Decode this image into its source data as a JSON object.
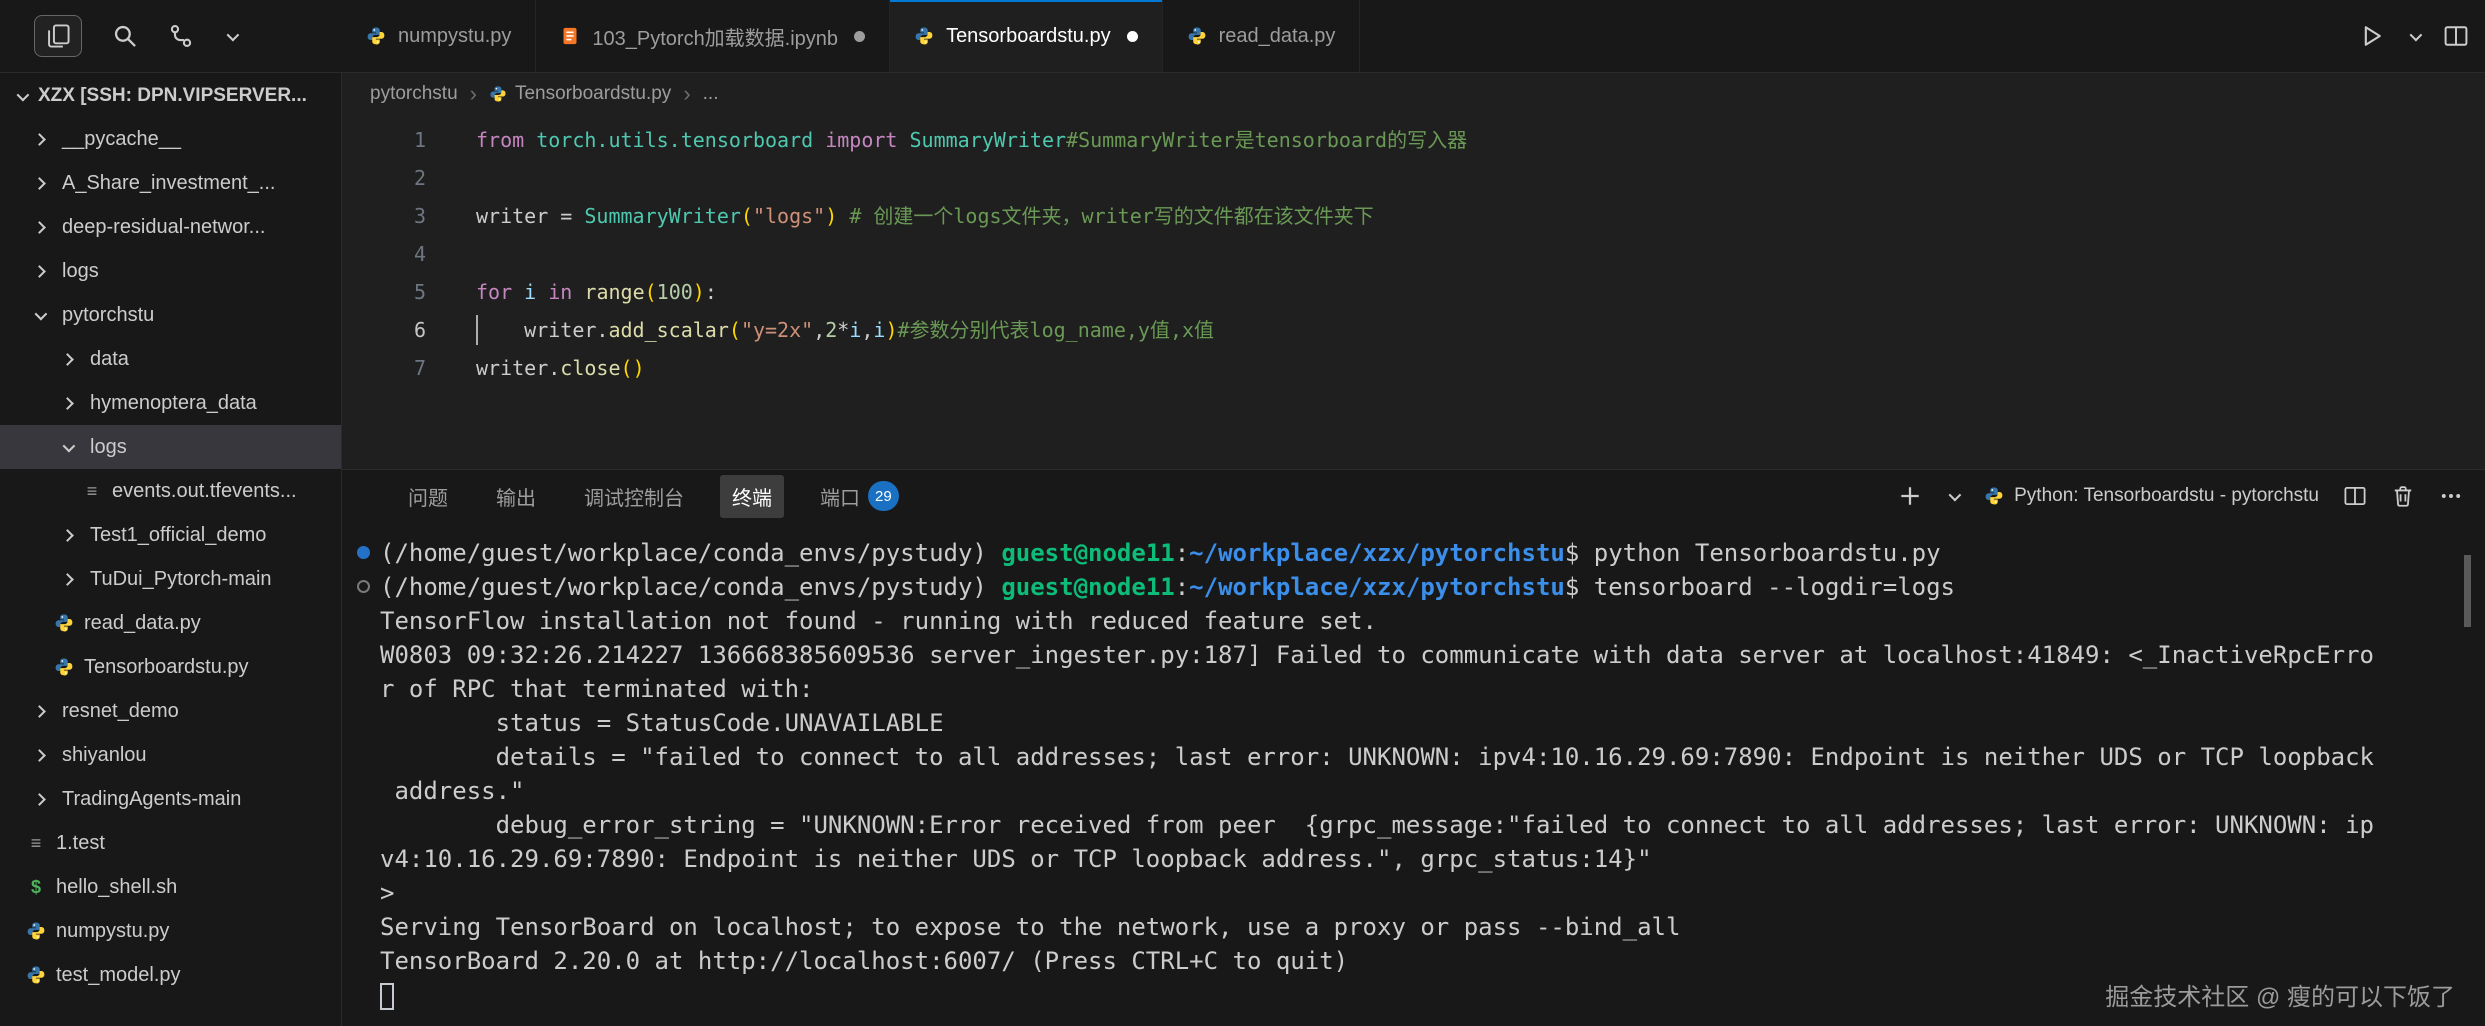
{
  "colors": {
    "accent_blue": "#0078d4",
    "terminal_green": "#0dbc79",
    "terminal_blue": "#3b8eea",
    "badge_blue": "#1a70c2",
    "python_blue": "#3776ab",
    "python_yellow": "#ffd43b",
    "notebook_orange": "#f37726",
    "shell_green": "#4eb15b"
  },
  "titlebar": {
    "activity_icons": [
      {
        "name": "files-icon",
        "key": "files",
        "boxed": true
      },
      {
        "name": "search-icon",
        "key": "search",
        "boxed": false
      },
      {
        "name": "source-control-graph-icon",
        "key": "graph",
        "boxed": false
      },
      {
        "name": "views-chevron-down-icon",
        "key": "chev-down",
        "boxed": false
      }
    ],
    "editor_actions": [
      {
        "name": "run-python-file-icon",
        "key": "run"
      },
      {
        "name": "run-dropdown-chevron-icon",
        "key": "chev-down"
      },
      {
        "name": "split-editor-icon",
        "key": "split"
      }
    ],
    "tabs": [
      {
        "label": "numpystu.py",
        "icon": "python",
        "modified": false,
        "active": false
      },
      {
        "label": "103_Pytorch加载数据.ipynb",
        "icon": "notebook",
        "modified": true,
        "active": false
      },
      {
        "label": "Tensorboardstu.py",
        "icon": "python",
        "modified": true,
        "active": true
      },
      {
        "label": "read_data.py",
        "icon": "python",
        "modified": false,
        "active": false
      }
    ]
  },
  "sidebar": {
    "title": "XZX [SSH: DPN.VIPSERVER...",
    "items": [
      {
        "label": "__pycache__",
        "kind": "folder",
        "level": 0,
        "expanded": false
      },
      {
        "label": "A_Share_investment_...",
        "kind": "folder",
        "level": 0,
        "expanded": false
      },
      {
        "label": "deep-residual-networ...",
        "kind": "folder",
        "level": 0,
        "expanded": false
      },
      {
        "label": "logs",
        "kind": "folder",
        "level": 0,
        "expanded": false
      },
      {
        "label": "pytorchstu",
        "kind": "folder",
        "level": 0,
        "expanded": true
      },
      {
        "label": "data",
        "kind": "folder",
        "level": 1,
        "expanded": false
      },
      {
        "label": "hymenoptera_data",
        "kind": "folder",
        "level": 1,
        "expanded": false
      },
      {
        "label": "logs",
        "kind": "folder",
        "level": 1,
        "expanded": true,
        "selected": true
      },
      {
        "label": "events.out.tfevents...",
        "kind": "file",
        "icon": "list",
        "level": 2
      },
      {
        "label": "Test1_official_demo",
        "kind": "folder",
        "level": 1,
        "expanded": false
      },
      {
        "label": "TuDui_Pytorch-main",
        "kind": "folder",
        "level": 1,
        "expanded": false
      },
      {
        "label": "read_data.py",
        "kind": "file",
        "icon": "python",
        "level": 1
      },
      {
        "label": "Tensorboardstu.py",
        "kind": "file",
        "icon": "python",
        "level": 1
      },
      {
        "label": "resnet_demo",
        "kind": "folder",
        "level": 0,
        "expanded": false
      },
      {
        "label": "shiyanlou",
        "kind": "folder",
        "level": 0,
        "expanded": false
      },
      {
        "label": "TradingAgents-main",
        "kind": "folder",
        "level": 0,
        "expanded": false
      },
      {
        "label": "1.test",
        "kind": "file",
        "icon": "list",
        "level": 0
      },
      {
        "label": "hello_shell.sh",
        "kind": "file",
        "icon": "shell",
        "level": 0
      },
      {
        "label": "numpystu.py",
        "kind": "file",
        "icon": "python",
        "level": 0
      },
      {
        "label": "test_model.py",
        "kind": "file",
        "icon": "python",
        "level": 0
      }
    ]
  },
  "breadcrumb": [
    {
      "label": "pytorchstu"
    },
    {
      "label": "Tensorboardstu.py",
      "icon": "python"
    },
    {
      "label": "..."
    }
  ],
  "editor": {
    "lines": [
      {
        "num": "1",
        "tokens": [
          [
            "from",
            "kw"
          ],
          [
            " ",
            "pln"
          ],
          [
            "torch.utils.tensorboard",
            "type"
          ],
          [
            " ",
            "pln"
          ],
          [
            "import",
            "kw"
          ],
          [
            " ",
            "pln"
          ],
          [
            "SummaryWriter",
            "type"
          ],
          [
            "#SummaryWriter是tensorboard的写入器",
            "cmt"
          ]
        ]
      },
      {
        "num": "2",
        "tokens": []
      },
      {
        "num": "3",
        "tokens": [
          [
            "writer",
            "pln"
          ],
          [
            " = ",
            "pln"
          ],
          [
            "SummaryWriter",
            "type"
          ],
          [
            "(",
            "brk"
          ],
          [
            "\"logs\"",
            "str"
          ],
          [
            ")",
            "brk"
          ],
          [
            " ",
            "pln"
          ],
          [
            "# 创建一个logs文件夹，writer写的文件都在该文件夹下",
            "cmt"
          ]
        ]
      },
      {
        "num": "4",
        "tokens": []
      },
      {
        "num": "5",
        "tokens": [
          [
            "for",
            "kw"
          ],
          [
            " ",
            "pln"
          ],
          [
            "i",
            "var"
          ],
          [
            " ",
            "pln"
          ],
          [
            "in",
            "kw"
          ],
          [
            " ",
            "pln"
          ],
          [
            "range",
            "fn"
          ],
          [
            "(",
            "brk"
          ],
          [
            "100",
            "num"
          ],
          [
            ")",
            "brk"
          ],
          [
            ":",
            "pln"
          ]
        ]
      },
      {
        "num": "6",
        "cursor": true,
        "tokens": [
          [
            "    ",
            "pln"
          ],
          [
            "writer",
            "pln"
          ],
          [
            ".",
            "pln"
          ],
          [
            "add_scalar",
            "fn"
          ],
          [
            "(",
            "brk"
          ],
          [
            "\"y=2x\"",
            "str"
          ],
          [
            ",",
            "pln"
          ],
          [
            "2",
            "num"
          ],
          [
            "*",
            "pln"
          ],
          [
            "i",
            "var"
          ],
          [
            ",",
            "pln"
          ],
          [
            "i",
            "var"
          ],
          [
            ")",
            "brk"
          ],
          [
            "#参数分别代表log_name,y值,x值",
            "cmt"
          ]
        ]
      },
      {
        "num": "7",
        "tokens": [
          [
            "writer",
            "pln"
          ],
          [
            ".",
            "pln"
          ],
          [
            "close",
            "fn"
          ],
          [
            "(",
            "brk"
          ],
          [
            ")",
            "brk"
          ]
        ]
      }
    ]
  },
  "panel": {
    "tabs": [
      {
        "label": "问题",
        "active": false
      },
      {
        "label": "输出",
        "active": false
      },
      {
        "label": "调试控制台",
        "active": false
      },
      {
        "label": "终端",
        "active": true
      },
      {
        "label": "端口",
        "active": false,
        "badge": "29"
      }
    ],
    "actions": {
      "session_label": "Python: Tensorboardstu - pytorchstu"
    },
    "terminal": {
      "lines": [
        {
          "marker": "success",
          "segs": [
            [
              "(/home/guest/workplace/conda_envs/pystudy) ",
              "tfg"
            ],
            [
              "guest@node11",
              "tgreen"
            ],
            [
              ":",
              "tfg"
            ],
            [
              "~/workplace/xzx/pytorchstu",
              "tblue"
            ],
            [
              "$ ",
              "tfg"
            ],
            [
              "python Tensorboardstu.py",
              "tfg"
            ]
          ]
        },
        {
          "marker": "running",
          "segs": [
            [
              "(/home/guest/workplace/conda_envs/pystudy) ",
              "tfg"
            ],
            [
              "guest@node11",
              "tgreen"
            ],
            [
              ":",
              "tfg"
            ],
            [
              "~/workplace/xzx/pytorchstu",
              "tblue"
            ],
            [
              "$ ",
              "tfg"
            ],
            [
              "tensorboard --logdir=logs",
              "tfg"
            ]
          ]
        },
        {
          "segs": [
            [
              "TensorFlow installation not found - running with reduced feature set.",
              "tfg"
            ]
          ]
        },
        {
          "segs": [
            [
              "W0803 09:32:26.214227 136668385609536 server_ingester.py:187] Failed to communicate with data server at localhost:41849: <_InactiveRpcErro",
              "tfg"
            ]
          ]
        },
        {
          "segs": [
            [
              "r of RPC that terminated with:",
              "tfg"
            ]
          ]
        },
        {
          "segs": [
            [
              "        status = StatusCode.UNAVAILABLE",
              "tfg"
            ]
          ]
        },
        {
          "segs": [
            [
              "        details = \"failed to connect to all addresses; last error: UNKNOWN: ipv4:10.16.29.69:7890: Endpoint is neither UDS or TCP loopback",
              "tfg"
            ]
          ]
        },
        {
          "segs": [
            [
              " address.\"",
              "tfg"
            ]
          ]
        },
        {
          "segs": [
            [
              "        debug_error_string = \"UNKNOWN:Error received from peer  {grpc_message:\"failed to connect to all addresses; last error: UNKNOWN: ip",
              "tfg"
            ]
          ]
        },
        {
          "segs": [
            [
              "v4:10.16.29.69:7890: Endpoint is neither UDS or TCP loopback address.\", grpc_status:14}\"",
              "tfg"
            ]
          ]
        },
        {
          "segs": [
            [
              ">",
              "tfg"
            ]
          ]
        },
        {
          "segs": [
            [
              "Serving TensorBoard on localhost; to expose to the network, use a proxy or pass --bind_all",
              "tfg"
            ]
          ]
        },
        {
          "segs": [
            [
              "TensorBoard 2.20.0 at http://localhost:6007/ (Press CTRL+C to quit)",
              "tfg"
            ]
          ]
        },
        {
          "cursor": true,
          "segs": []
        }
      ]
    }
  },
  "watermark": "掘金技术社区 @ 瘦的可以下饭了"
}
